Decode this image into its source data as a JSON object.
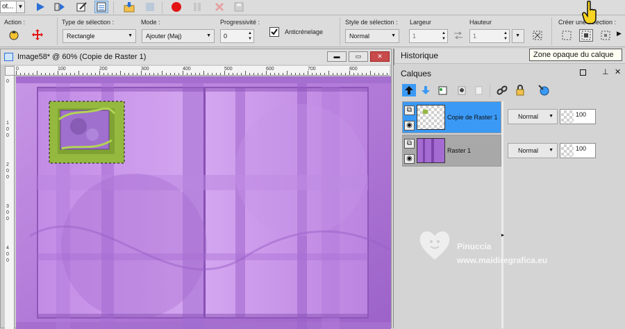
{
  "toolbar": {
    "preset_label": "ot...",
    "icons": [
      "play-icon",
      "step-run-icon",
      "edit-icon",
      "script-list-icon",
      "folder-import-icon",
      "square-icon",
      "record-icon",
      "pause-icon",
      "cancel-icon",
      "save-icon"
    ]
  },
  "options": {
    "action_label": "Action :",
    "selection_type_label": "Type de sélection :",
    "selection_type_value": "Rectangle",
    "mode_label": "Mode :",
    "mode_value": "Ajouter (Maj)",
    "progressivity_label": "Progressivité :",
    "progressivity_value": "0",
    "antialias_label": "Anticrénelage",
    "antialias_checked": true,
    "selection_style_label": "Style de sélection :",
    "selection_style_value": "Normal",
    "width_label": "Largeur",
    "width_value": "1",
    "height_label": "Hauteur",
    "height_value": "1",
    "create_selection_label": "Créer une sélection :"
  },
  "tooltip": "Zone opaque du calque",
  "image_window": {
    "title": "Image58* @  60% (Copie de Raster 1)",
    "ruler_h_ticks": [
      "0",
      "100",
      "200",
      "300",
      "400",
      "500",
      "600",
      "700",
      "800"
    ],
    "ruler_v_ticks": [
      "0",
      "1 0 0",
      "2 0 0",
      "3 0 0",
      "4 0 0"
    ],
    "canvas_bg": "#b47fd6"
  },
  "history_panel": {
    "title": "Historique"
  },
  "layers_panel": {
    "title": "Calques",
    "layers": [
      {
        "name": "Copie de Raster 1",
        "blend": "Normal",
        "opacity": "100",
        "selected": true
      },
      {
        "name": "Raster 1",
        "blend": "Normal",
        "opacity": "100",
        "selected": false
      }
    ]
  },
  "watermark": {
    "name": "Pinuccia",
    "url": "www.maidiregrafica.eu"
  },
  "colors": {
    "accent": "#3a99f5",
    "purple": "#b47fd6",
    "green_frame": "#95b83f"
  }
}
